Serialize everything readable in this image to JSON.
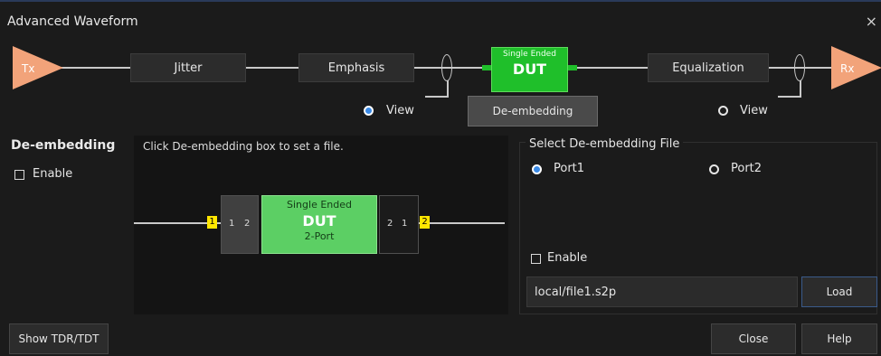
{
  "window": {
    "title": "Advanced Waveform",
    "close_symbol": "×"
  },
  "chain": {
    "tx_label": "Tx",
    "rx_label": "Rx",
    "jitter_label": "Jitter",
    "emphasis_label": "Emphasis",
    "dut_small": "Single Ended",
    "dut_big": "DUT",
    "equalization_label": "Equalization",
    "view_left_label": "View",
    "view_right_label": "View",
    "deembed_button": "De-embedding"
  },
  "deembed": {
    "title": "De-embedding",
    "enable_label": "Enable",
    "hint": "Click De-embedding box to set a file.",
    "port_left": {
      "num1": "1",
      "num2": "2",
      "tag": "1"
    },
    "dut_small": "Single Ended",
    "dut_big": "DUT",
    "dut_sub": "2-Port",
    "port_right": {
      "num1": "2",
      "num2": "1",
      "tag": "2"
    }
  },
  "file_panel": {
    "title": "Select De-embedding File",
    "port1_label": "Port1",
    "port2_label": "Port2",
    "enable_label": "Enable",
    "file_value": "local/file1.s2p",
    "load_label": "Load",
    "selected_port": "Port1"
  },
  "footer": {
    "show_tdr_label": "Show TDR/TDT",
    "close_label": "Close",
    "help_label": "Help"
  },
  "colors": {
    "accent": "#3b8ae6",
    "dut_green": "#1fbf2a",
    "tx_rx": "#f2a37a",
    "port_tag": "#ffe600"
  }
}
